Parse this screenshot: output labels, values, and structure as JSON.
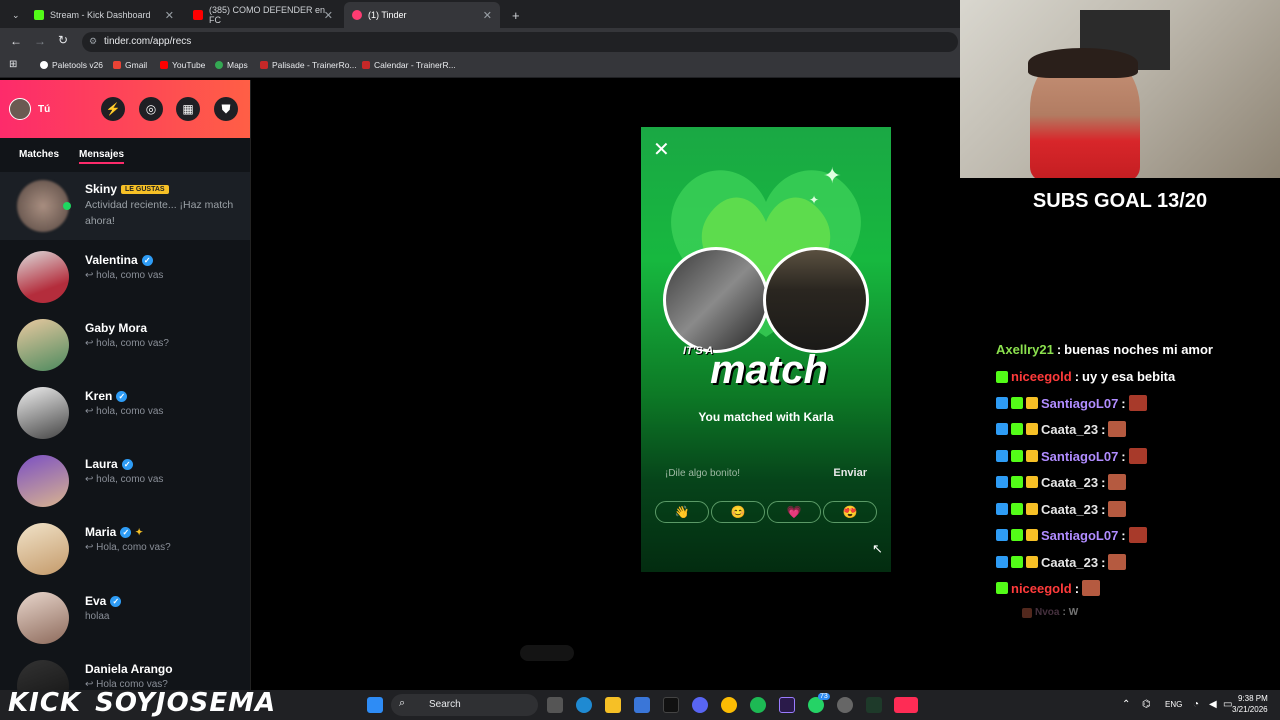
{
  "browser": {
    "tabs": [
      {
        "label": "Stream - Kick Dashboard",
        "color": "#53fc18"
      },
      {
        "label": "(385) COMO DEFENDER en FC",
        "color": "#ff0000"
      },
      {
        "label": "(1) Tinder",
        "color": "#fe3c72"
      }
    ],
    "url": "tinder.com/app/recs",
    "bookmarks": [
      "Paletools v26",
      "Gmail",
      "YouTube",
      "Maps",
      "Palisade - TrainerRo...",
      "Calendar - TrainerR..."
    ]
  },
  "tinder": {
    "profile_label": "Tú",
    "tabs": {
      "matches": "Matches",
      "messages": "Mensajes"
    },
    "conversations": [
      {
        "name": "Skiny",
        "badge": "LE GUSTAS",
        "preview": "Actividad reciente... ¡Haz match",
        "preview2": "ahora!",
        "verified": false
      },
      {
        "name": "Valentina",
        "preview": "hola, como vas",
        "verified": true
      },
      {
        "name": "Gaby Mora",
        "preview": "hola, como vas?",
        "verified": false
      },
      {
        "name": "Kren",
        "preview": "hola, como vas",
        "verified": true
      },
      {
        "name": "Laura",
        "preview": "hola, como vas",
        "verified": true
      },
      {
        "name": "Maria",
        "preview": "Hola, como vas?",
        "verified": true
      },
      {
        "name": "Eva",
        "preview": "holaa",
        "verified": true
      },
      {
        "name": "Daniela Arango",
        "preview": "Hola como vas?",
        "verified": false
      }
    ],
    "match_modal": {
      "kicker": "IT'S A",
      "title": "match",
      "subtitle": "You matched with Karla",
      "input_placeholder": "¡Dile algo bonito!",
      "send_label": "Enviar",
      "quick_emojis": [
        "👋",
        "😊",
        "💗",
        "😍"
      ]
    }
  },
  "stream": {
    "subs_goal": "SUBS GOAL 13/20",
    "chat": [
      {
        "user": "Axellry21",
        "message": "buenas noches mi amor",
        "color": "#8be04e"
      },
      {
        "user": "niceegold",
        "message": "uy y esa bebita",
        "color": "#ff3b3b"
      },
      {
        "user": "SantiagoL07",
        "message": "",
        "color": "#b08cff"
      },
      {
        "user": "Caata_23",
        "message": "",
        "color": "#e6e6e6"
      },
      {
        "user": "SantiagoL07",
        "message": "",
        "color": "#b08cff"
      },
      {
        "user": "Caata_23",
        "message": "",
        "color": "#e6e6e6"
      },
      {
        "user": "Caata_23",
        "message": "",
        "color": "#e6e6e6"
      },
      {
        "user": "SantiagoL07",
        "message": "",
        "color": "#b08cff"
      },
      {
        "user": "Caata_23",
        "message": "",
        "color": "#e6e6e6"
      },
      {
        "user": "niceegold",
        "message": "",
        "color": "#ff3b3b"
      },
      {
        "user": "Nvoa",
        "message": "W",
        "color": "#9a6c8a"
      }
    ],
    "brand_left": "KICK",
    "brand_right": "SOYJOSEMA"
  },
  "taskbar": {
    "search_label": "Search",
    "language": "ENG",
    "time": "9:38 PM",
    "date": "3/21/2026",
    "whatsapp_badge": "73"
  }
}
